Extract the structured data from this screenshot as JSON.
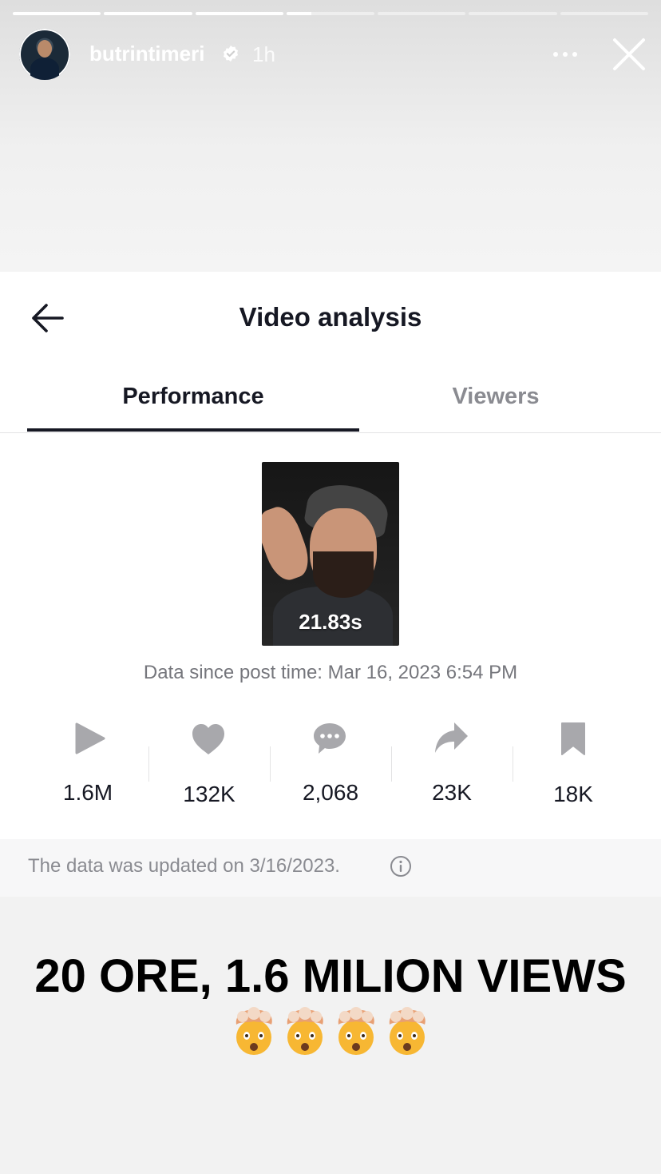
{
  "story": {
    "username": "butrintimeri",
    "time": "1h",
    "progress_segments": [
      1,
      1,
      1,
      0.28,
      0,
      0,
      0
    ]
  },
  "header": {
    "title": "Video analysis"
  },
  "tabs": [
    {
      "label": "Performance",
      "active": true
    },
    {
      "label": "Viewers",
      "active": false
    }
  ],
  "video": {
    "duration": "21.83s"
  },
  "data_since": "Data since post time: Mar 16, 2023 6:54 PM",
  "stats": [
    {
      "icon": "play-icon",
      "value": "1.6M"
    },
    {
      "icon": "heart-icon",
      "value": "132K"
    },
    {
      "icon": "comment-icon",
      "value": "2,068"
    },
    {
      "icon": "share-icon",
      "value": "23K"
    },
    {
      "icon": "bookmark-icon",
      "value": "18K"
    }
  ],
  "updated_note": "The data was updated on 3/16/2023.",
  "caption": "20 ORE, 1.6 MILION VIEWS",
  "emoji_count": 4,
  "colors": {
    "text_primary": "#161823",
    "text_secondary": "#8a8b91",
    "icon_gray": "#a8a8ac"
  }
}
